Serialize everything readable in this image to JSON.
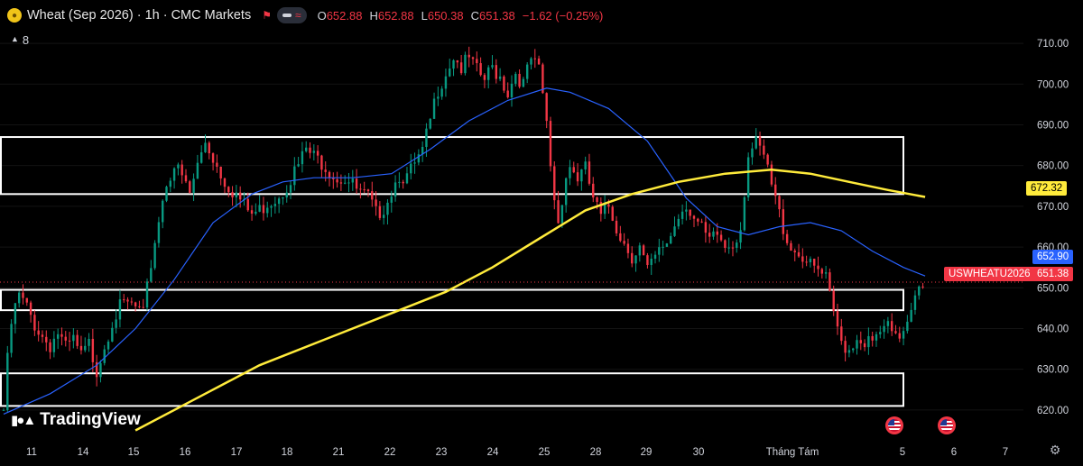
{
  "header": {
    "title": "Wheat (Sep 2026) · 1h · CMC Markets",
    "ohlc": [
      {
        "label": "O",
        "value": "652.88"
      },
      {
        "label": "H",
        "value": "652.88"
      },
      {
        "label": "L",
        "value": "650.38"
      },
      {
        "label": "C",
        "value": "651.38"
      }
    ],
    "change": "−1.62 (−0.25%)",
    "indicator_count": "8"
  },
  "brand": "TradingView",
  "colors": {
    "up": "#089981",
    "down": "#f23645",
    "ma_fast": "#2962ff",
    "ma_slow": "#ffeb3b",
    "background": "#000000",
    "axis_text": "#d1d4dc"
  },
  "tags": {
    "ma_slow_value": "672.32",
    "ma_fast_value": "652.90",
    "symbol": "USWHEATU2026",
    "last_price": "651.38"
  },
  "chart_data": {
    "type": "candlestick",
    "symbol": "USWHEATU2026",
    "ylim": [
      614,
      714
    ],
    "y_ticks": [
      620,
      630,
      640,
      650,
      660,
      670,
      680,
      690,
      700,
      710
    ],
    "x_ticks": [
      "11",
      "14",
      "15",
      "16",
      "17",
      "18",
      "21",
      "22",
      "23",
      "24",
      "25",
      "28",
      "29",
      "30",
      "Tháng Tám",
      "5",
      "6",
      "7"
    ],
    "close_points": [
      [
        0.0,
        620
      ],
      [
        0.5,
        632
      ],
      [
        1.0,
        641
      ],
      [
        1.5,
        645
      ],
      [
        2.0,
        648
      ],
      [
        3.0,
        645
      ],
      [
        4.0,
        641
      ],
      [
        5.0,
        638
      ],
      [
        6.0,
        636
      ],
      [
        7.0,
        639
      ],
      [
        8.0,
        635
      ],
      [
        9.0,
        637
      ],
      [
        10.0,
        633
      ],
      [
        11.0,
        636
      ],
      [
        12.0,
        630
      ],
      [
        13.0,
        636
      ],
      [
        14.0,
        642
      ],
      [
        15.0,
        645
      ],
      [
        16.0,
        646
      ],
      [
        17.0,
        645
      ],
      [
        18.0,
        643
      ],
      [
        19.0,
        656
      ],
      [
        20.0,
        667
      ],
      [
        21.0,
        676
      ],
      [
        22.0,
        680
      ],
      [
        23.0,
        677
      ],
      [
        24.0,
        673
      ],
      [
        25.0,
        680
      ],
      [
        26.0,
        686
      ],
      [
        27.0,
        682
      ],
      [
        28.0,
        678
      ],
      [
        29.0,
        675
      ],
      [
        30.0,
        673
      ],
      [
        31.0,
        670
      ],
      [
        32.0,
        668
      ],
      [
        33.0,
        669
      ],
      [
        34.0,
        671
      ],
      [
        35.0,
        672
      ],
      [
        36.0,
        674
      ],
      [
        37.0,
        677
      ],
      [
        38.0,
        680
      ],
      [
        39.0,
        684
      ],
      [
        40.0,
        682
      ],
      [
        41.0,
        681
      ],
      [
        42.0,
        679
      ],
      [
        43.0,
        677
      ],
      [
        44.0,
        677
      ],
      [
        45.0,
        675
      ],
      [
        46.0,
        673
      ],
      [
        47.0,
        672
      ],
      [
        48.0,
        668
      ],
      [
        49.0,
        670
      ],
      [
        50.0,
        674
      ],
      [
        51.0,
        678
      ],
      [
        52.0,
        677
      ],
      [
        53.0,
        680
      ],
      [
        54.0,
        683
      ],
      [
        55.0,
        691
      ],
      [
        56.0,
        699
      ],
      [
        57.0,
        703
      ],
      [
        58.0,
        707
      ],
      [
        59.0,
        704
      ],
      [
        60.0,
        706
      ],
      [
        61.0,
        703
      ],
      [
        62.0,
        701
      ],
      [
        63.0,
        704
      ],
      [
        64.0,
        702
      ],
      [
        65.0,
        698
      ],
      [
        66.0,
        703
      ],
      [
        67.0,
        700
      ],
      [
        68.0,
        706
      ],
      [
        69.0,
        703
      ],
      [
        69.8,
        694
      ],
      [
        70.4,
        682
      ],
      [
        71.0,
        672
      ],
      [
        71.6,
        665
      ],
      [
        72.2,
        676
      ],
      [
        73.0,
        680
      ],
      [
        74.0,
        677
      ],
      [
        75.0,
        679
      ],
      [
        76.0,
        672
      ],
      [
        77.0,
        667
      ],
      [
        78.0,
        670
      ],
      [
        79.0,
        665
      ],
      [
        80.0,
        661
      ],
      [
        81.0,
        658
      ],
      [
        82.0,
        660
      ],
      [
        83.0,
        654
      ],
      [
        84.0,
        657
      ],
      [
        85.0,
        660
      ],
      [
        86.0,
        663
      ],
      [
        87.0,
        668
      ],
      [
        88.0,
        671
      ],
      [
        89.0,
        667
      ],
      [
        90.0,
        664
      ],
      [
        91.0,
        661
      ],
      [
        92.0,
        663
      ],
      [
        93.0,
        660
      ],
      [
        94.0,
        661
      ],
      [
        95.0,
        665
      ],
      [
        96.0,
        683
      ],
      [
        97.0,
        685
      ],
      [
        98.0,
        682
      ],
      [
        99.0,
        675
      ],
      [
        100.0,
        668
      ],
      [
        101.0,
        662
      ],
      [
        102.0,
        659
      ],
      [
        103.0,
        658
      ],
      [
        104.0,
        655
      ],
      [
        105.0,
        654
      ],
      [
        106.0,
        652
      ],
      [
        107.0,
        643
      ],
      [
        108.0,
        637
      ],
      [
        109.0,
        635
      ],
      [
        110.0,
        638
      ],
      [
        111.0,
        637
      ],
      [
        112.0,
        636
      ],
      [
        113.0,
        639
      ],
      [
        114.0,
        640
      ],
      [
        115.0,
        637
      ],
      [
        116.0,
        640
      ],
      [
        117.0,
        646
      ],
      [
        118.0,
        652
      ],
      [
        118.8,
        651.38
      ]
    ],
    "x_domain": [
      0,
      131
    ],
    "series": [
      {
        "name": "",
        "kind": "moving-average-fast",
        "points": [
          [
            0,
            619
          ],
          [
            6,
            624
          ],
          [
            12,
            631
          ],
          [
            17,
            640
          ],
          [
            22,
            652
          ],
          [
            27,
            666
          ],
          [
            32,
            673
          ],
          [
            36,
            676
          ],
          [
            40,
            677
          ],
          [
            45,
            677
          ],
          [
            50,
            678
          ],
          [
            55,
            684
          ],
          [
            60,
            691
          ],
          [
            65,
            696
          ],
          [
            70,
            699
          ],
          [
            73,
            698
          ],
          [
            78,
            694
          ],
          [
            83,
            686
          ],
          [
            88,
            672
          ],
          [
            92,
            665
          ],
          [
            96,
            663
          ],
          [
            100,
            665
          ],
          [
            104,
            666
          ],
          [
            108,
            664
          ],
          [
            112,
            659
          ],
          [
            116,
            655
          ],
          [
            118.8,
            652.9
          ]
        ]
      },
      {
        "name": "",
        "kind": "moving-average-slow",
        "points": [
          [
            17,
            615
          ],
          [
            25,
            623
          ],
          [
            33,
            631
          ],
          [
            41,
            637
          ],
          [
            49,
            643
          ],
          [
            57,
            649
          ],
          [
            63,
            655
          ],
          [
            69,
            662
          ],
          [
            75,
            669
          ],
          [
            81,
            673
          ],
          [
            87,
            676
          ],
          [
            93,
            678
          ],
          [
            99,
            679
          ],
          [
            104,
            678
          ],
          [
            109,
            676
          ],
          [
            114,
            674
          ],
          [
            118.8,
            672.3
          ]
        ]
      }
    ],
    "zones": [
      {
        "from": 673,
        "to": 687
      },
      {
        "from": 644.5,
        "to": 649.5
      },
      {
        "from": 621,
        "to": 629
      }
    ],
    "last_price_line": 651.38
  }
}
